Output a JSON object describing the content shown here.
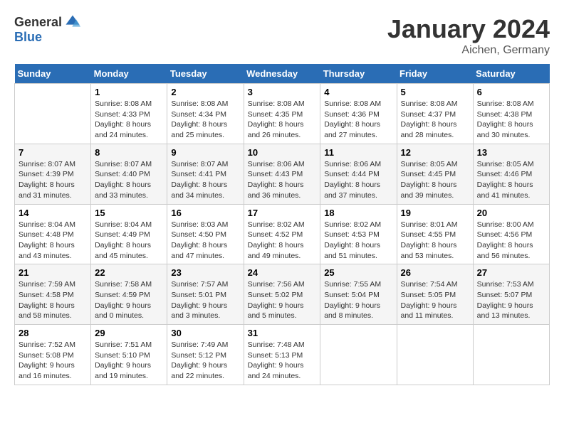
{
  "logo": {
    "general": "General",
    "blue": "Blue"
  },
  "title": "January 2024",
  "location": "Aichen, Germany",
  "days_header": [
    "Sunday",
    "Monday",
    "Tuesday",
    "Wednesday",
    "Thursday",
    "Friday",
    "Saturday"
  ],
  "weeks": [
    [
      {
        "day": "",
        "info": ""
      },
      {
        "day": "1",
        "info": "Sunrise: 8:08 AM\nSunset: 4:33 PM\nDaylight: 8 hours\nand 24 minutes."
      },
      {
        "day": "2",
        "info": "Sunrise: 8:08 AM\nSunset: 4:34 PM\nDaylight: 8 hours\nand 25 minutes."
      },
      {
        "day": "3",
        "info": "Sunrise: 8:08 AM\nSunset: 4:35 PM\nDaylight: 8 hours\nand 26 minutes."
      },
      {
        "day": "4",
        "info": "Sunrise: 8:08 AM\nSunset: 4:36 PM\nDaylight: 8 hours\nand 27 minutes."
      },
      {
        "day": "5",
        "info": "Sunrise: 8:08 AM\nSunset: 4:37 PM\nDaylight: 8 hours\nand 28 minutes."
      },
      {
        "day": "6",
        "info": "Sunrise: 8:08 AM\nSunset: 4:38 PM\nDaylight: 8 hours\nand 30 minutes."
      }
    ],
    [
      {
        "day": "7",
        "info": "Sunrise: 8:07 AM\nSunset: 4:39 PM\nDaylight: 8 hours\nand 31 minutes."
      },
      {
        "day": "8",
        "info": "Sunrise: 8:07 AM\nSunset: 4:40 PM\nDaylight: 8 hours\nand 33 minutes."
      },
      {
        "day": "9",
        "info": "Sunrise: 8:07 AM\nSunset: 4:41 PM\nDaylight: 8 hours\nand 34 minutes."
      },
      {
        "day": "10",
        "info": "Sunrise: 8:06 AM\nSunset: 4:43 PM\nDaylight: 8 hours\nand 36 minutes."
      },
      {
        "day": "11",
        "info": "Sunrise: 8:06 AM\nSunset: 4:44 PM\nDaylight: 8 hours\nand 37 minutes."
      },
      {
        "day": "12",
        "info": "Sunrise: 8:05 AM\nSunset: 4:45 PM\nDaylight: 8 hours\nand 39 minutes."
      },
      {
        "day": "13",
        "info": "Sunrise: 8:05 AM\nSunset: 4:46 PM\nDaylight: 8 hours\nand 41 minutes."
      }
    ],
    [
      {
        "day": "14",
        "info": "Sunrise: 8:04 AM\nSunset: 4:48 PM\nDaylight: 8 hours\nand 43 minutes."
      },
      {
        "day": "15",
        "info": "Sunrise: 8:04 AM\nSunset: 4:49 PM\nDaylight: 8 hours\nand 45 minutes."
      },
      {
        "day": "16",
        "info": "Sunrise: 8:03 AM\nSunset: 4:50 PM\nDaylight: 8 hours\nand 47 minutes."
      },
      {
        "day": "17",
        "info": "Sunrise: 8:02 AM\nSunset: 4:52 PM\nDaylight: 8 hours\nand 49 minutes."
      },
      {
        "day": "18",
        "info": "Sunrise: 8:02 AM\nSunset: 4:53 PM\nDaylight: 8 hours\nand 51 minutes."
      },
      {
        "day": "19",
        "info": "Sunrise: 8:01 AM\nSunset: 4:55 PM\nDaylight: 8 hours\nand 53 minutes."
      },
      {
        "day": "20",
        "info": "Sunrise: 8:00 AM\nSunset: 4:56 PM\nDaylight: 8 hours\nand 56 minutes."
      }
    ],
    [
      {
        "day": "21",
        "info": "Sunrise: 7:59 AM\nSunset: 4:58 PM\nDaylight: 8 hours\nand 58 minutes."
      },
      {
        "day": "22",
        "info": "Sunrise: 7:58 AM\nSunset: 4:59 PM\nDaylight: 9 hours\nand 0 minutes."
      },
      {
        "day": "23",
        "info": "Sunrise: 7:57 AM\nSunset: 5:01 PM\nDaylight: 9 hours\nand 3 minutes."
      },
      {
        "day": "24",
        "info": "Sunrise: 7:56 AM\nSunset: 5:02 PM\nDaylight: 9 hours\nand 5 minutes."
      },
      {
        "day": "25",
        "info": "Sunrise: 7:55 AM\nSunset: 5:04 PM\nDaylight: 9 hours\nand 8 minutes."
      },
      {
        "day": "26",
        "info": "Sunrise: 7:54 AM\nSunset: 5:05 PM\nDaylight: 9 hours\nand 11 minutes."
      },
      {
        "day": "27",
        "info": "Sunrise: 7:53 AM\nSunset: 5:07 PM\nDaylight: 9 hours\nand 13 minutes."
      }
    ],
    [
      {
        "day": "28",
        "info": "Sunrise: 7:52 AM\nSunset: 5:08 PM\nDaylight: 9 hours\nand 16 minutes."
      },
      {
        "day": "29",
        "info": "Sunrise: 7:51 AM\nSunset: 5:10 PM\nDaylight: 9 hours\nand 19 minutes."
      },
      {
        "day": "30",
        "info": "Sunrise: 7:49 AM\nSunset: 5:12 PM\nDaylight: 9 hours\nand 22 minutes."
      },
      {
        "day": "31",
        "info": "Sunrise: 7:48 AM\nSunset: 5:13 PM\nDaylight: 9 hours\nand 24 minutes."
      },
      {
        "day": "",
        "info": ""
      },
      {
        "day": "",
        "info": ""
      },
      {
        "day": "",
        "info": ""
      }
    ]
  ]
}
